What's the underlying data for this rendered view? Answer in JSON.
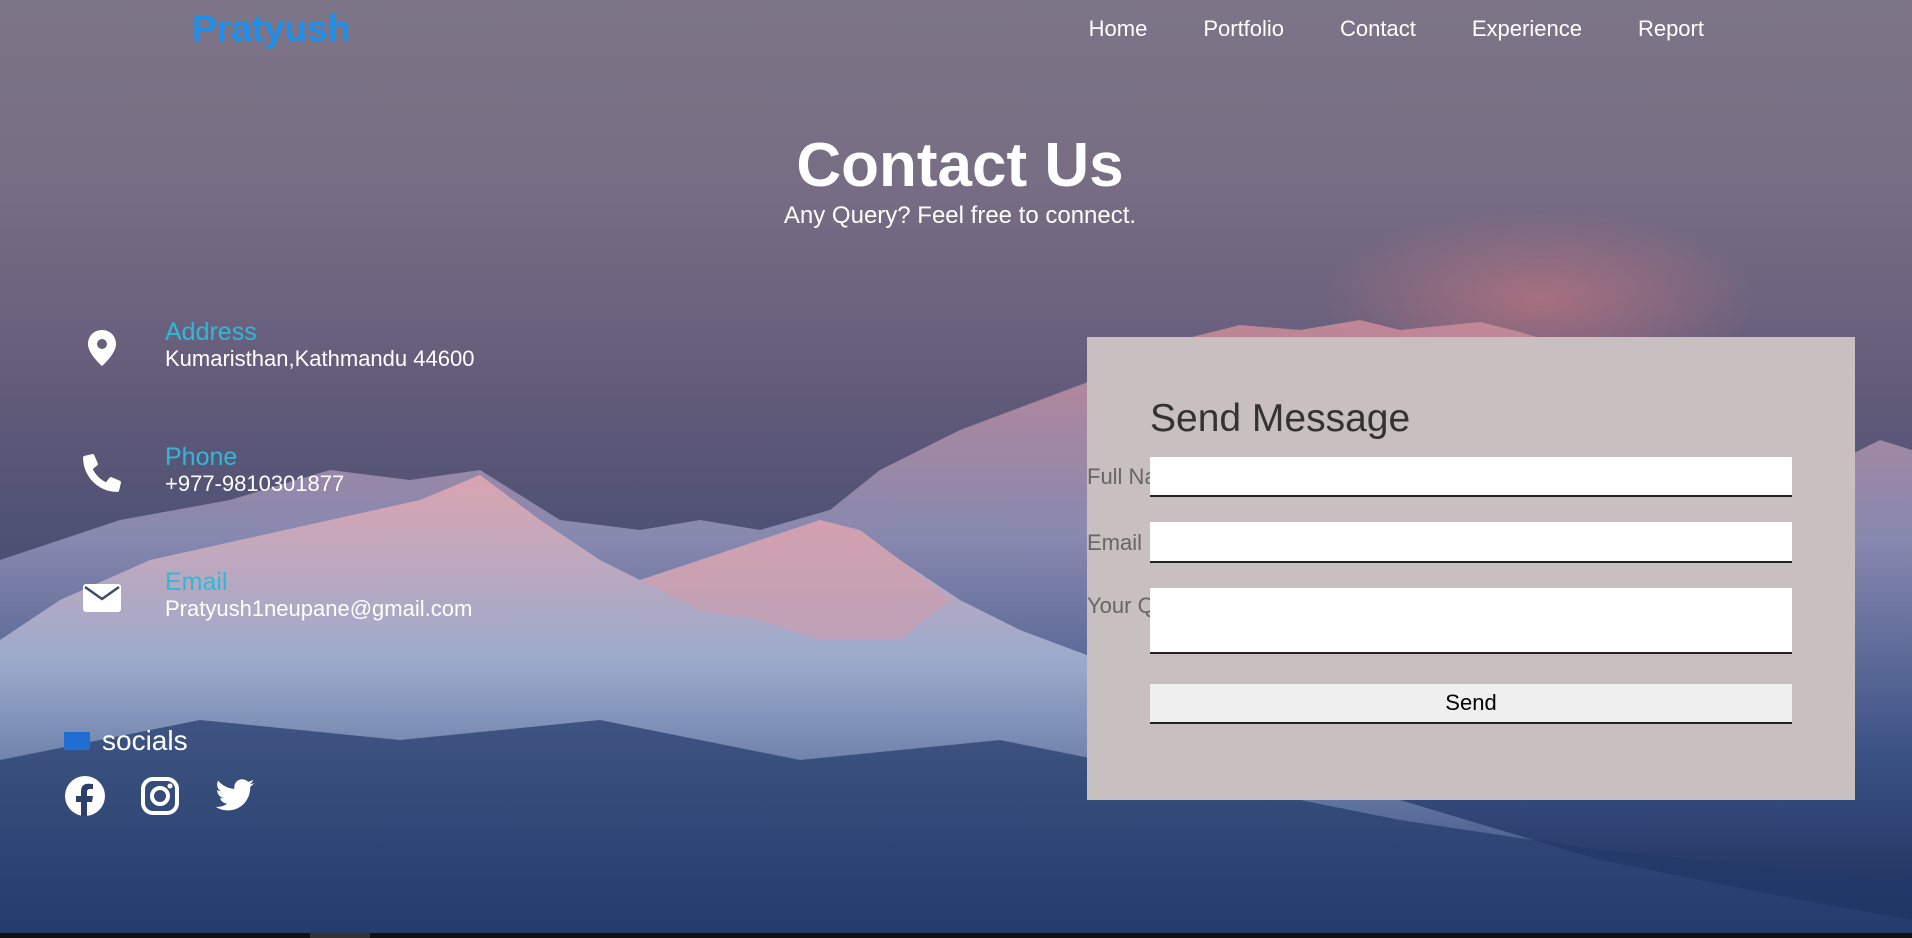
{
  "header": {
    "logo": "Pratyush",
    "nav": [
      "Home",
      "Portfolio",
      "Contact",
      "Experience",
      "Report"
    ]
  },
  "hero": {
    "title": "Contact Us",
    "subtitle": "Any Query? Feel free to connect."
  },
  "contact_info": [
    {
      "icon": "location-pin-icon",
      "label": "Address",
      "value": "Kumaristhan,Kathmandu 44600"
    },
    {
      "icon": "phone-icon",
      "label": "Phone",
      "value": "+977-9810301877"
    },
    {
      "icon": "envelope-icon",
      "label": "Email",
      "value": "Pratyush1neupane@gmail.com"
    }
  ],
  "socials": {
    "heading": "socials",
    "icons": [
      "facebook-icon",
      "instagram-icon",
      "twitter-icon"
    ]
  },
  "form": {
    "title": "Send Message",
    "fields": {
      "full_name": {
        "label": "Full Name",
        "value": ""
      },
      "email": {
        "label": "Email",
        "value": ""
      },
      "query": {
        "label": "Your Query",
        "value": ""
      }
    },
    "send_label": "Send"
  },
  "colors": {
    "logo": "#1e8fe8",
    "info_label": "#2fb9d8",
    "form_bg": "#c8bfc0",
    "socials_bar": "#1e6fd1"
  }
}
